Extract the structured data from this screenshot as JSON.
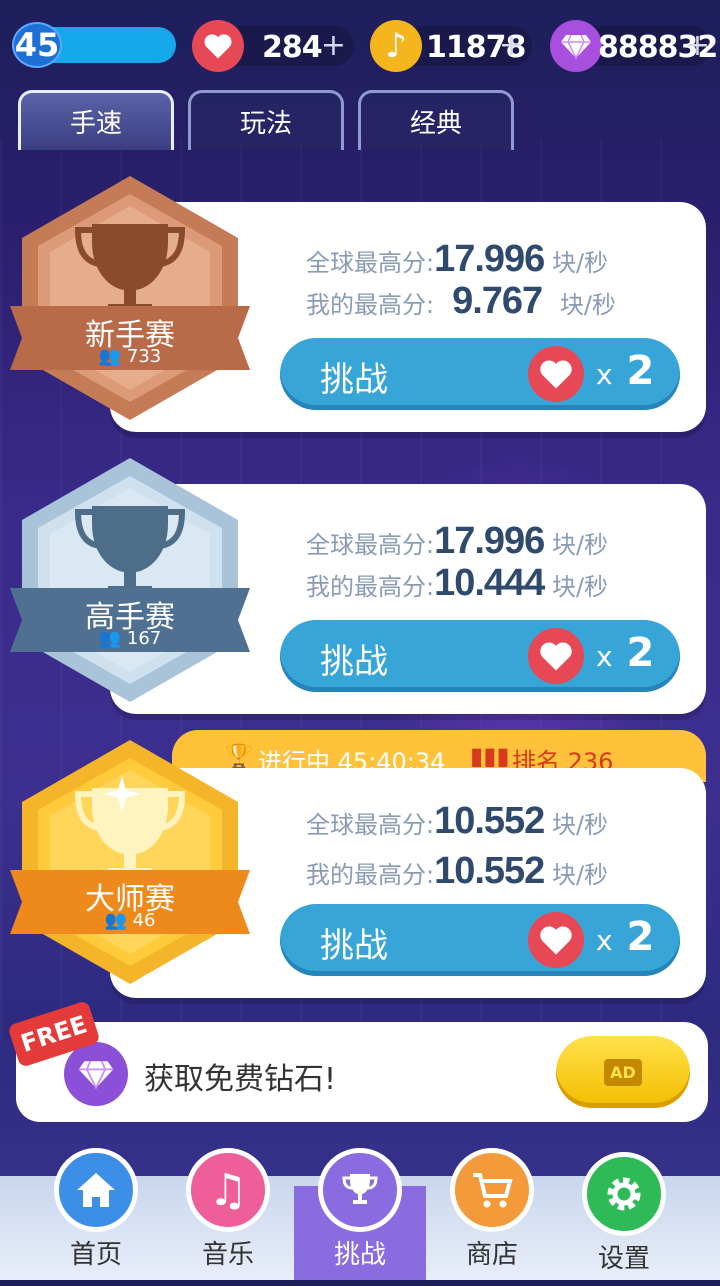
{
  "top_bar": {
    "level": "45",
    "hearts": "284",
    "notes": "11878",
    "diamonds": "888832",
    "plus": "+"
  },
  "tabs": [
    {
      "label": "手速",
      "active": true
    },
    {
      "label": "玩法",
      "active": false
    },
    {
      "label": "经典",
      "active": false
    }
  ],
  "contests": [
    {
      "name": "新手赛",
      "participants": "733",
      "global_label": "全球最高分:",
      "global_value": "17.996",
      "mine_label": "我的最高分:",
      "mine_value": "9.767",
      "unit": "块/秒",
      "button": "挑战",
      "cost": "2",
      "x": "x",
      "color": "#c9825f"
    },
    {
      "name": "高手赛",
      "participants": "167",
      "global_label": "全球最高分:",
      "global_value": "17.996",
      "mine_label": "我的最高分:",
      "mine_value": "10.444",
      "unit": "块/秒",
      "button": "挑战",
      "cost": "2",
      "x": "x",
      "color": "#6c8fae"
    },
    {
      "name": "大师赛",
      "participants": "46",
      "global_label": "全球最高分:",
      "global_value": "10.552",
      "mine_label": "我的最高分:",
      "mine_value": "10.552",
      "unit": "块/秒",
      "button": "挑战",
      "cost": "2",
      "x": "x",
      "color": "#f0a21e"
    }
  ],
  "event": {
    "status": "进行中 45:40:34",
    "rank": "排名 236"
  },
  "free_diamonds": {
    "badge": "FREE",
    "text": "获取免费钻石!",
    "ad": "AD"
  },
  "nav": [
    {
      "label": "首页",
      "color": "#3d8ee6"
    },
    {
      "label": "音乐",
      "color": "#ee5f9a"
    },
    {
      "label": "挑战",
      "color": "#8a6be0",
      "active": true
    },
    {
      "label": "商店",
      "color": "#f39a3a"
    },
    {
      "label": "设置",
      "color": "#2fba58"
    }
  ]
}
